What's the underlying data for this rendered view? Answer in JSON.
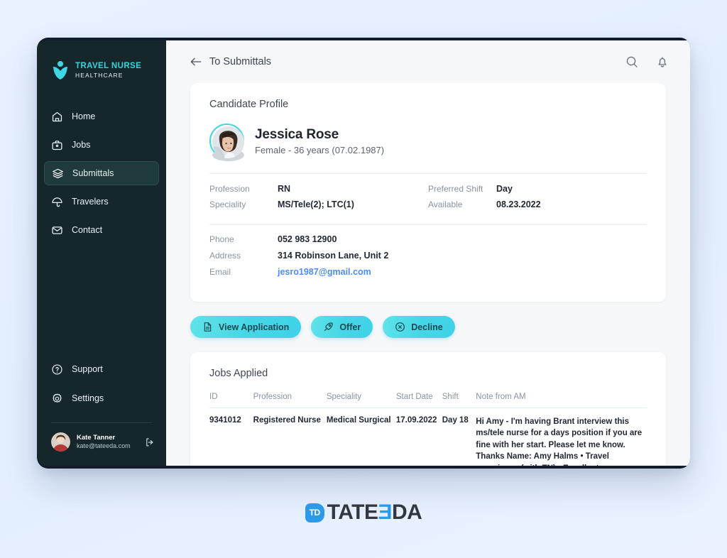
{
  "brand": {
    "title": "TRAVEL NURSE",
    "subtitle": "HEALTHCARE",
    "accent": "#35d4dd"
  },
  "sidebar": {
    "items": [
      {
        "label": "Home",
        "icon": "home-icon",
        "active": false
      },
      {
        "label": "Jobs",
        "icon": "briefcase-icon",
        "active": false
      },
      {
        "label": "Submittals",
        "icon": "layers-icon",
        "active": true
      },
      {
        "label": "Travelers",
        "icon": "umbrella-icon",
        "active": false
      },
      {
        "label": "Contact",
        "icon": "mail-icon",
        "active": false
      }
    ],
    "bottom_items": [
      {
        "label": "Support",
        "icon": "question-circle-icon"
      },
      {
        "label": "Settings",
        "icon": "gear-icon"
      }
    ],
    "user": {
      "name": "Kate Tanner",
      "email": "kate@tateeda.com",
      "logout_icon": "logout-icon"
    }
  },
  "topbar": {
    "back_label": "To Submittals",
    "back_icon": "arrow-left-icon",
    "search_icon": "search-icon",
    "bell_icon": "bell-icon"
  },
  "profile_card": {
    "title": "Candidate Profile",
    "name": "Jessica Rose",
    "subtitle": "Female - 36 years (07.02.1987)",
    "avatar_ring_color": "#3ed7e3",
    "fields_left": [
      {
        "label": "Profession",
        "value": "RN"
      },
      {
        "label": "Speciality",
        "value": "MS/Tele(2); LTC(1)"
      }
    ],
    "fields_right": [
      {
        "label": "Preferred Shift",
        "value": "Day"
      },
      {
        "label": "Available",
        "value": "08.23.2022"
      }
    ],
    "contact": [
      {
        "label": "Phone",
        "value": "052 983 12900",
        "link": false
      },
      {
        "label": "Address",
        "value": "314 Robinson Lane, Unit 2",
        "link": false
      },
      {
        "label": "Email",
        "value": "jesro1987@gmail.com",
        "link": true
      }
    ]
  },
  "actions": [
    {
      "label": "View Application",
      "icon": "document-icon"
    },
    {
      "label": "Offer",
      "icon": "rocket-icon"
    },
    {
      "label": "Decline",
      "icon": "x-circle-icon"
    }
  ],
  "jobs_applied": {
    "title": "Jobs Applied",
    "columns": [
      "ID",
      "Profession",
      "Speciality",
      "Start Date",
      "Shift",
      "Note from AM"
    ],
    "rows": [
      {
        "id": "9341012",
        "profession": "Registered Nurse",
        "speciality": "Medical Surgical",
        "start_date": "17.09.2022",
        "shift": "Day 18",
        "note": "Hi Amy - I'm having Brant interview this ms/tele nurse for a days position if you are fine with her start. Please let me know. Thanks Name: Amy Halms • Travel experience (with TN) - Excellent References, \"She is always a team plaver.\""
      }
    ]
  },
  "footer_logo": {
    "badge": "TD",
    "part1": "TATE",
    "part2_reversed": "E",
    "part3": "DA",
    "accent": "#2b9ae8"
  }
}
